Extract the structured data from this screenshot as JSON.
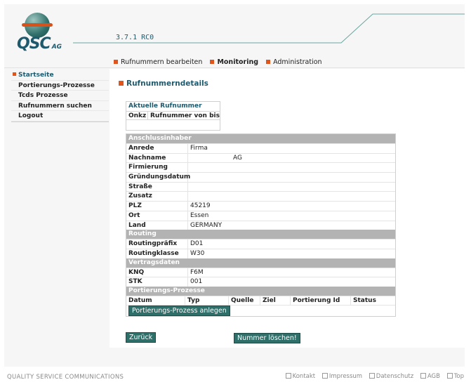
{
  "header": {
    "logo_text": "QSC",
    "logo_suffix": "AG",
    "version": "3.7.1 RC0"
  },
  "topnav": [
    {
      "label": "Rufnummern bearbeiten",
      "active": false
    },
    {
      "label": "Monitoring",
      "active": true
    },
    {
      "label": "Administration",
      "active": false
    }
  ],
  "sidebar": [
    {
      "label": "Startseite",
      "active": true
    },
    {
      "label": "Portierungs-Prozesse",
      "active": false
    },
    {
      "label": "Tcds Prozesse",
      "active": false
    },
    {
      "label": "Rufnummern suchen",
      "active": false
    },
    {
      "label": "Logout",
      "active": false
    }
  ],
  "page": {
    "title": "Rufnummerndetails",
    "aktuelle": {
      "title": "Aktuelle Rufnummer",
      "col_onkz": "Onkz",
      "col_range": "Rufnummer von bis"
    },
    "anschluss": {
      "section": "Anschlussinhaber",
      "rows": [
        {
          "label": "Anrede",
          "value": "Firma"
        },
        {
          "label": "Nachname",
          "value": "AG"
        },
        {
          "label": "Firmierung",
          "value": ""
        },
        {
          "label": "Gründungsdatum",
          "value": ""
        },
        {
          "label": "Straße",
          "value": ""
        },
        {
          "label": "Zusatz",
          "value": ""
        },
        {
          "label": "PLZ",
          "value": "45219"
        },
        {
          "label": "Ort",
          "value": "Essen"
        },
        {
          "label": "Land",
          "value": "GERMANY"
        }
      ]
    },
    "routing": {
      "section": "Routing",
      "rows": [
        {
          "label": "Routingpräfix",
          "value": "D01"
        },
        {
          "label": "Routingklasse",
          "value": "W30"
        }
      ]
    },
    "vertrag": {
      "section": "Vertragsdaten",
      "rows": [
        {
          "label": "KNQ",
          "value": "F6M"
        },
        {
          "label": "STK",
          "value": "001"
        }
      ]
    },
    "portierung": {
      "section": "Portierungs-Prozesse",
      "columns": [
        "Datum",
        "Typ",
        "Quelle",
        "Ziel",
        "Portierung Id",
        "Status"
      ],
      "create_button": "Portierungs-Prozess anlegen"
    },
    "back_button": "Zurück",
    "delete_button": "Nummer löschen!"
  },
  "footer": {
    "brand": "QUALITY SERVICE COMMUNICATIONS",
    "links": [
      "Kontakt",
      "Impressum",
      "Datenschutz",
      "AGB",
      "Top"
    ]
  },
  "colors": {
    "accent_orange": "#e0551b",
    "brand_teal": "#1e5a6e",
    "button_teal": "#2f6f6a",
    "section_gray": "#b3b3b3"
  }
}
